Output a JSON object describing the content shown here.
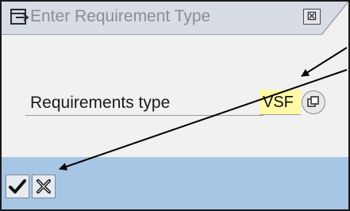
{
  "window": {
    "title": "Enter Requirement Type",
    "close_glyph": "⊠",
    "title_icon": "dialog-window-icon"
  },
  "form": {
    "field_label": "Requirements type",
    "field_value": "VSF",
    "field_background": "#fff9a6",
    "value_help_icon": "search-help-icon"
  },
  "toolbar": {
    "confirm_icon": "check-icon",
    "cancel_icon": "cancel-x-icon",
    "background": "#a7c6e6"
  }
}
